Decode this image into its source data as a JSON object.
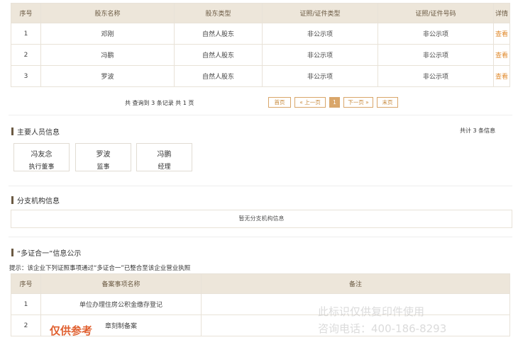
{
  "shareholders": {
    "headers": [
      "序号",
      "股东名称",
      "股东类型",
      "证照/证件类型",
      "证照/证件号码",
      "详情"
    ],
    "rows": [
      {
        "index": "1",
        "name": "邓刚",
        "type": "自然人股东",
        "id_type": "非公示项",
        "id_number": "非公示项",
        "action": "查看"
      },
      {
        "index": "2",
        "name": "冯鹏",
        "type": "自然人股东",
        "id_type": "非公示项",
        "id_number": "非公示项",
        "action": "查看"
      },
      {
        "index": "3",
        "name": "罗波",
        "type": "自然人股东",
        "id_type": "非公示项",
        "id_number": "非公示项",
        "action": "查看"
      }
    ]
  },
  "pagination": {
    "summary": "共 查询到 3 条记录 共 1 页",
    "first": "首页",
    "prev": "« 上一页",
    "current": "1",
    "next": "下一页 »",
    "last": "末页"
  },
  "key_personnel": {
    "title": "主要人员信息",
    "count": "共计 3 条信息",
    "people": [
      {
        "name": "冯友念",
        "role": "执行董事"
      },
      {
        "name": "罗波",
        "role": "监事"
      },
      {
        "name": "冯鹏",
        "role": "经理"
      }
    ]
  },
  "branches": {
    "title": "分支机构信息",
    "empty": "暂无分支机构信息"
  },
  "multi_cert": {
    "title": "“多证合一”信息公示",
    "hint": "提示：该企业下列证照事项通过“多证合一”已整合至该企业营业执照",
    "headers": [
      "序号",
      "备案事项名称",
      "备注"
    ],
    "rows": [
      {
        "index": "1",
        "name": "单位办理住房公积金缴存登记",
        "note": ""
      },
      {
        "index": "2",
        "name": "章刻制备案",
        "note": ""
      }
    ]
  },
  "watermarks": {
    "bottom_line1": "此标识仅供复印件使用",
    "bottom_line2": "咨询电话：400-186-8293",
    "reference": "仅供参考"
  }
}
